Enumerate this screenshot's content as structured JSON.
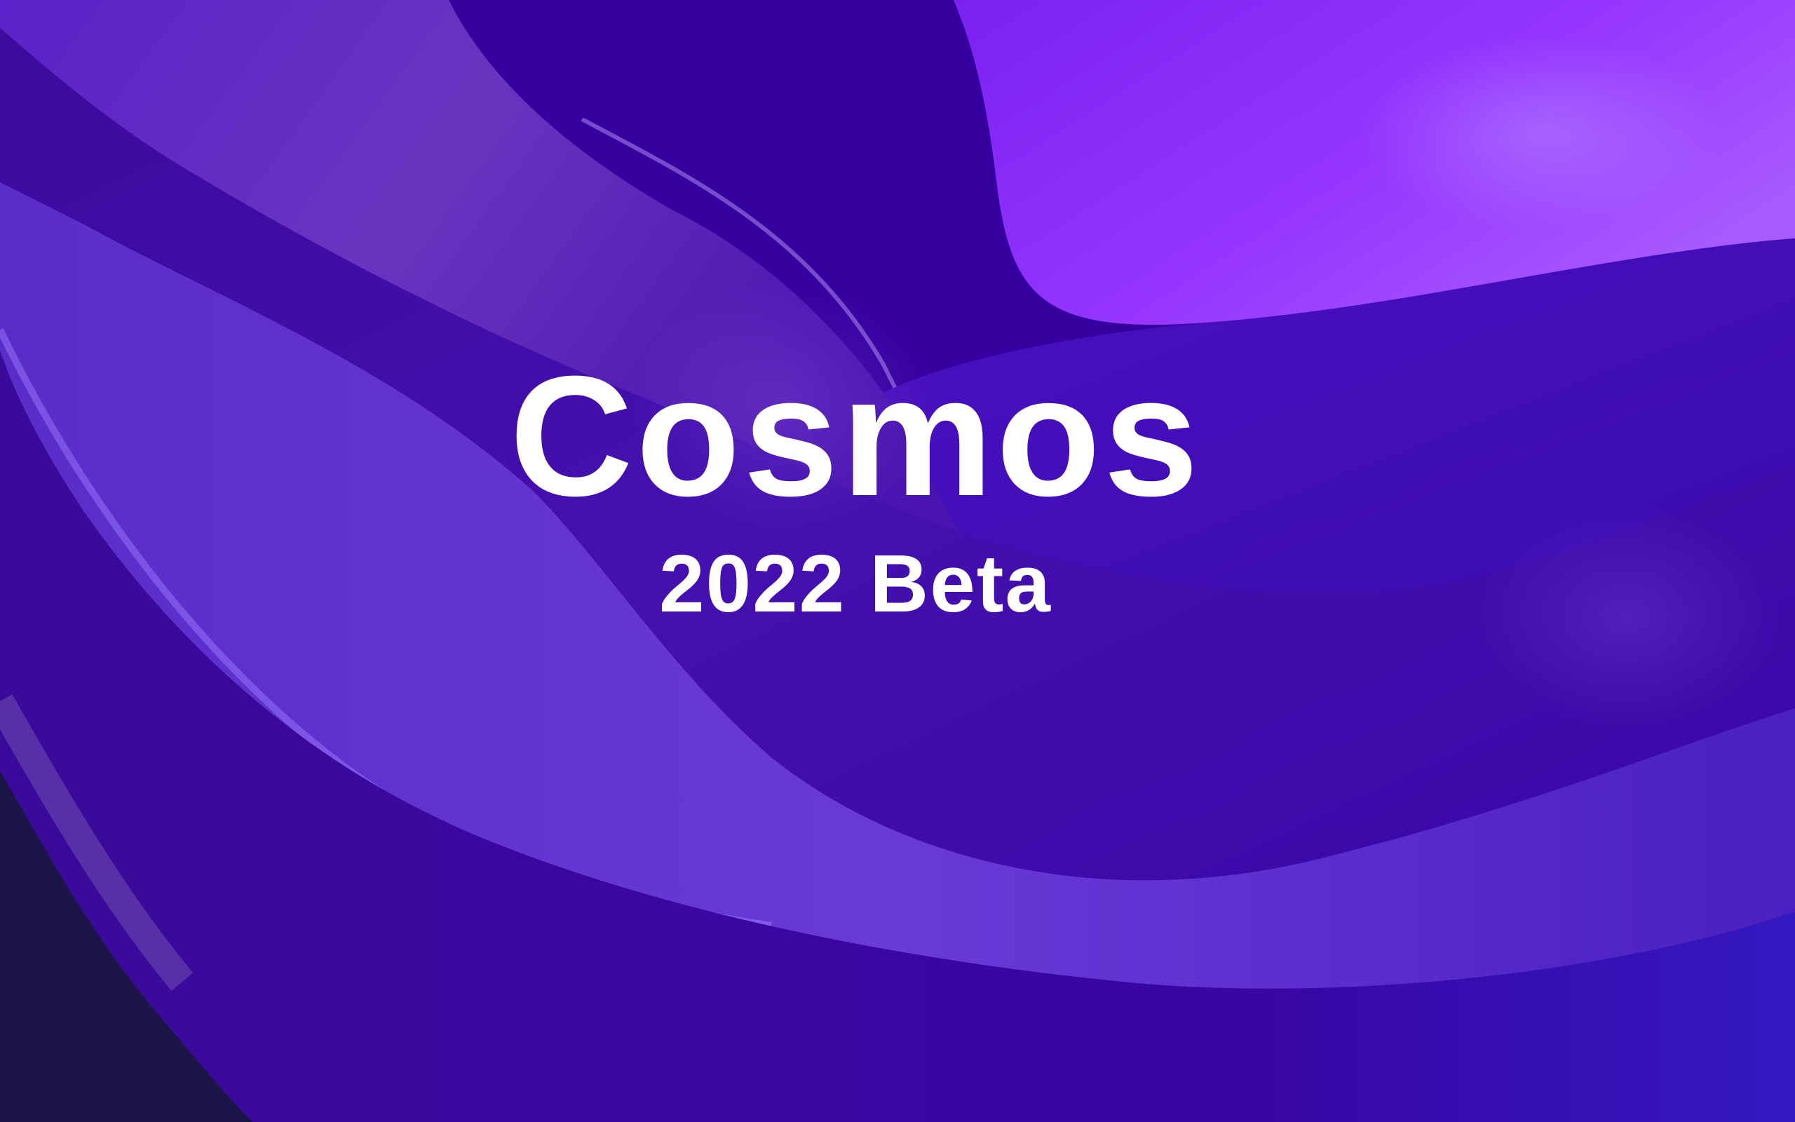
{
  "splash": {
    "title": "Cosmos",
    "subtitle": "2022 Beta"
  },
  "colors": {
    "text": "#ffffff",
    "deep_violet": "#2a0a8a",
    "bright_violet": "#9a3cff",
    "mid_violet": "#5418c8",
    "dark_navy": "#1c1548",
    "accent_blue": "#4a3cff"
  }
}
